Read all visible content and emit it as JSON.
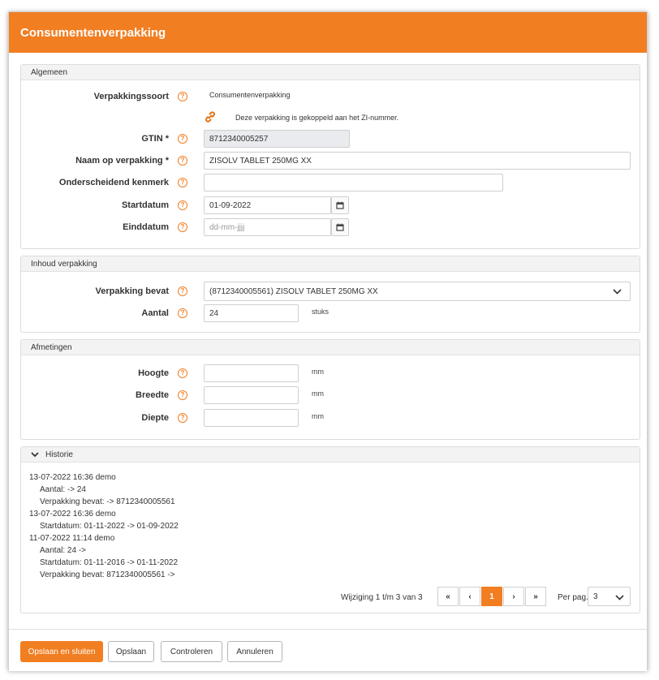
{
  "dialog": {
    "title": "Consumentenverpakking"
  },
  "algemeen": {
    "heading": "Algemeen",
    "verpakkingssoort_label": "Verpakkingssoort",
    "verpakkingssoort_value": "Consumentenverpakking",
    "link_note": "Deze verpakking is gekoppeld aan het ZI-nummer.",
    "gtin_label": "GTIN *",
    "gtin_value": "8712340005257",
    "naam_label": "Naam op verpakking *",
    "naam_value": "ZISOLV TABLET 250MG XX",
    "kenmerk_label": "Onderscheidend kenmerk",
    "kenmerk_value": "",
    "startdatum_label": "Startdatum",
    "startdatum_value": "01-09-2022",
    "einddatum_label": "Einddatum",
    "einddatum_placeholder": "dd-mm-jjjj"
  },
  "inhoud": {
    "heading": "Inhoud verpakking",
    "bevat_label": "Verpakking bevat",
    "bevat_value": "(8712340005561) ZISOLV TABLET 250MG XX",
    "aantal_label": "Aantal",
    "aantal_value": "24",
    "aantal_unit": "stuks"
  },
  "afmetingen": {
    "heading": "Afmetingen",
    "hoogte_label": "Hoogte",
    "breedte_label": "Breedte",
    "diepte_label": "Diepte",
    "unit": "mm"
  },
  "historie": {
    "heading": "Historie",
    "lines": [
      {
        "text": "13-07-2022 16:36   demo",
        "indent": false
      },
      {
        "text": "Aantal: -> 24",
        "indent": true
      },
      {
        "text": "Verpakking bevat: -> 8712340005561",
        "indent": true
      },
      {
        "text": "13-07-2022 16:36   demo",
        "indent": false
      },
      {
        "text": "Startdatum: 01-11-2022 -> 01-09-2022",
        "indent": true
      },
      {
        "text": "11-07-2022 11:14   demo",
        "indent": false
      },
      {
        "text": "Aantal: 24 ->",
        "indent": true
      },
      {
        "text": "Startdatum: 01-11-2016 -> 01-11-2022",
        "indent": true
      },
      {
        "text": "Verpakking bevat: 8712340005561 ->",
        "indent": true
      }
    ],
    "summary": "Wijziging 1 t/m 3 van 3",
    "pager": {
      "first": "«",
      "prev": "‹",
      "page": "1",
      "next": "›",
      "last": "»"
    },
    "per_page_label": "Per pag.",
    "per_page_value": "3"
  },
  "footer": {
    "save_close": "Opslaan en sluiten",
    "save": "Opslaan",
    "check": "Controleren",
    "cancel": "Annuleren"
  },
  "colors": {
    "accent": "#f27e22"
  }
}
